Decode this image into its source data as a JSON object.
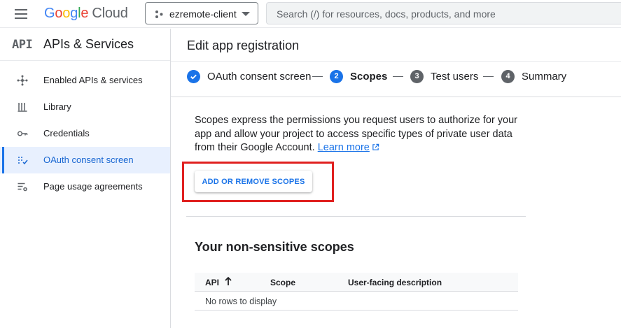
{
  "header": {
    "brand_google": "Google",
    "brand_cloud": "Cloud",
    "project_name": "ezremote-client",
    "search_placeholder": "Search (/) for resources, docs, products, and more"
  },
  "sidebar": {
    "logo_text": "API",
    "title": "APIs & Services",
    "items": [
      {
        "label": "Enabled APIs & services",
        "icon": "hub-icon"
      },
      {
        "label": "Library",
        "icon": "library-icon"
      },
      {
        "label": "Credentials",
        "icon": "key-icon"
      },
      {
        "label": "OAuth consent screen",
        "icon": "consent-icon",
        "active": true
      },
      {
        "label": "Page usage agreements",
        "icon": "settings-list-icon"
      }
    ]
  },
  "main": {
    "title": "Edit app registration",
    "steps": [
      {
        "label": "OAuth consent screen",
        "status": "done"
      },
      {
        "number": "2",
        "label": "Scopes",
        "status": "current"
      },
      {
        "number": "3",
        "label": "Test users",
        "status": "todo"
      },
      {
        "number": "4",
        "label": "Summary",
        "status": "todo"
      }
    ],
    "description": "Scopes express the permissions you request users to authorize for your app and allow your project to access specific types of private user data from their Google Account.",
    "learn_more": "Learn more",
    "add_scopes_button": "ADD OR REMOVE SCOPES",
    "section_title": "Your non-sensitive scopes",
    "table": {
      "columns": [
        "API",
        "Scope",
        "User-facing description"
      ],
      "empty_text": "No rows to display"
    }
  },
  "colors": {
    "accent": "#1a73e8",
    "highlight": "#e0201f",
    "active_bg": "#e8f0fe"
  }
}
